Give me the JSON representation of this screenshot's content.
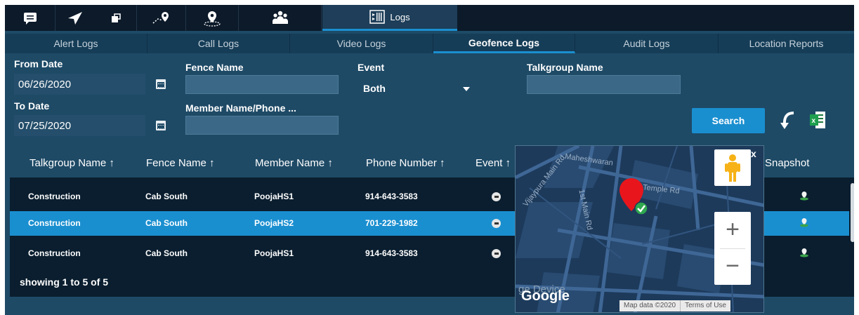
{
  "toolbar": {
    "tools": [
      {
        "name": "messages",
        "icon": "chat-icon"
      },
      {
        "name": "location",
        "icon": "navigation-icon"
      },
      {
        "name": "geofence",
        "icon": "route-pin-icon"
      },
      {
        "name": "place",
        "icon": "map-pin-icon"
      },
      {
        "name": "groups",
        "icon": "group-icon"
      }
    ],
    "logs_label": "Logs"
  },
  "tabs": [
    "Alert Logs",
    "Call Logs",
    "Video Logs",
    "Geofence Logs",
    "Audit Logs",
    "Location Reports"
  ],
  "active_tab": "Geofence Logs",
  "filters": {
    "from_date_label": "From Date",
    "from_date_value": "06/26/2020",
    "to_date_label": "To Date",
    "to_date_value": "07/25/2020",
    "fence_name_label": "Fence Name",
    "fence_name_value": "",
    "member_label": "Member Name/Phone ...",
    "member_value": "",
    "event_label": "Event",
    "event_value": "Both",
    "talkgroup_label": "Talkgroup Name",
    "talkgroup_value": "",
    "search_label": "Search"
  },
  "table": {
    "headers": {
      "talkgroup": "Talkgroup Name ↑",
      "fence": "Fence Name ↑",
      "member": "Member Name ↑",
      "phone": "Phone Number ↑",
      "event": "Event ↑",
      "snapshot": "Snapshot"
    },
    "rows": [
      {
        "talkgroup": "Construction",
        "fence": "Cab South",
        "member": "PoojaHS1",
        "phone": "914-643-3583"
      },
      {
        "talkgroup": "Construction",
        "fence": "Cab South",
        "member": "PoojaHS2",
        "phone": "701-229-1982"
      },
      {
        "talkgroup": "Construction",
        "fence": "Cab South",
        "member": "PoojaHS1",
        "phone": "914-643-3583"
      }
    ],
    "selected_row": 1,
    "footer": "showing 1 to 5 of 5"
  },
  "map": {
    "close_label": "x",
    "streets": [
      "Maheshwaran",
      "Temple Rd",
      "1st Main Rd",
      "Vijaypura Main Rd"
    ],
    "watermark": "ge Device",
    "logo": "Google",
    "attribution": [
      "Map data ©2020",
      "Terms of Use"
    ],
    "zoom_in": "+",
    "zoom_out": "−"
  },
  "colors": {
    "accent": "#1a8fd0",
    "background": "#1e4a66",
    "toolbar": "#0c1a2a"
  }
}
